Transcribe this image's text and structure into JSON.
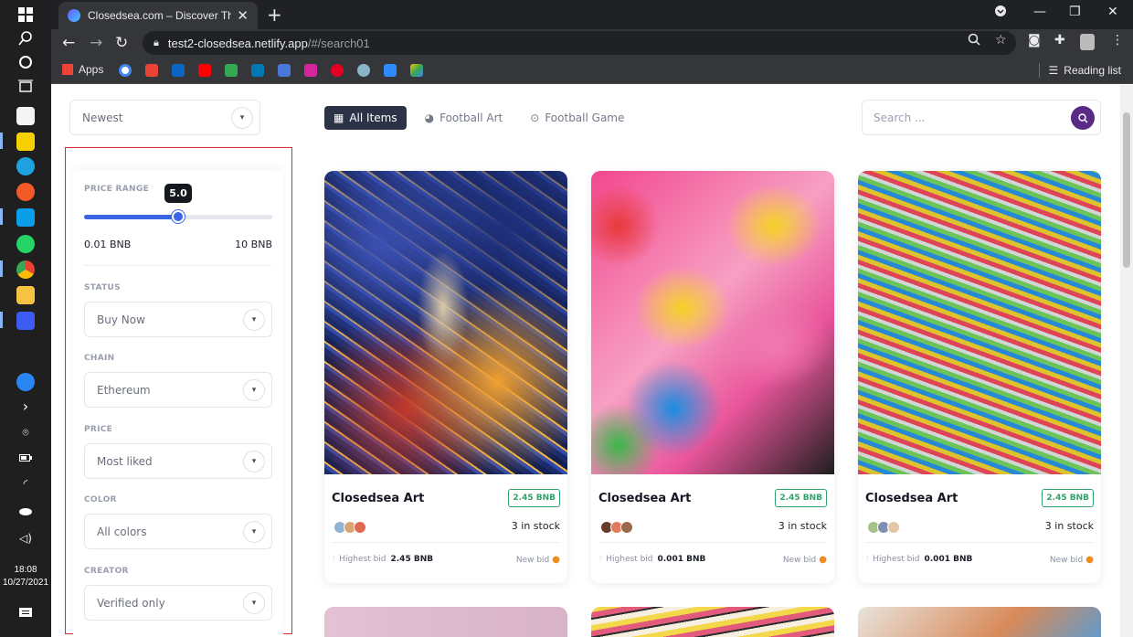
{
  "taskbar": {
    "time": "18:08",
    "date": "10/27/2021"
  },
  "browser": {
    "tab_title": "Closedsea.com – Discover The Be",
    "tab_close": "✕",
    "new_tab": "+",
    "url_host": "test2-closedsea.netlify.app",
    "url_path": "/#/search01",
    "bookmarks_apps": "Apps",
    "reading_list": "Reading list"
  },
  "page": {
    "sort_select": "Newest",
    "categories": [
      {
        "label": "All Items",
        "icon": "grid-icon"
      },
      {
        "label": "Football Art",
        "icon": "helmet-icon"
      },
      {
        "label": "Football Game",
        "icon": "ball-icon"
      }
    ],
    "search_placeholder": "Search ...",
    "filters": {
      "price_range_label": "PRICE RANGE",
      "price_range_value": "5.0",
      "price_range_fraction": 0.5,
      "range_min": "0.01 BNB",
      "range_max": "10 BNB",
      "status_label": "STATUS",
      "status_value": "Buy Now",
      "chain_label": "CHAIN",
      "chain_value": "Ethereum",
      "price_label": "PRICE",
      "price_value": "Most liked",
      "color_label": "COLOR",
      "color_value": "All colors",
      "creator_label": "CREATOR",
      "creator_value": "Verified only"
    },
    "cards": [
      {
        "title": "Closedsea Art",
        "price": "2.45 BNB",
        "stock": "3 in stock",
        "bid_label": "Highest bid",
        "bid_value": "2.45 BNB",
        "new_bid": "New bid"
      },
      {
        "title": "Closedsea Art",
        "price": "2.45 BNB",
        "stock": "3 in stock",
        "bid_label": "Highest bid",
        "bid_value": "0.001 BNB",
        "new_bid": "New bid"
      },
      {
        "title": "Closedsea Art",
        "price": "2.45 BNB",
        "stock": "3 in stock",
        "bid_label": "Highest bid",
        "bid_value": "0.001 BNB",
        "new_bid": "New bid"
      }
    ]
  },
  "colors": {
    "accent_blue": "#3a66e6",
    "price_green": "#2fa36b",
    "search_purple": "#5b2a86",
    "active_tab": "#2d3346"
  }
}
